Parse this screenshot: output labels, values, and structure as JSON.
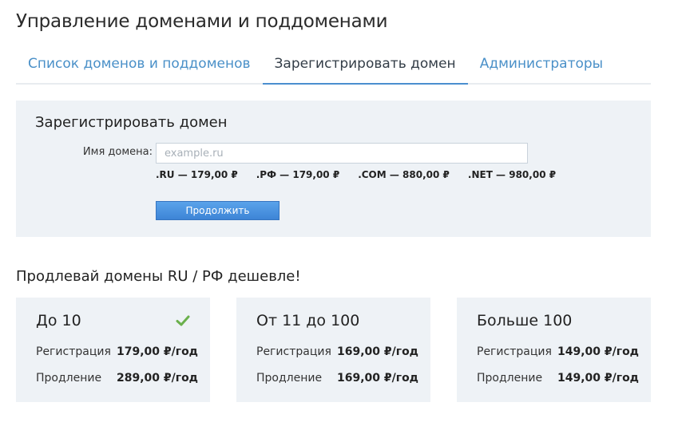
{
  "page": {
    "title": "Управление доменами и поддоменами"
  },
  "tabs": [
    {
      "label": "Список доменов и поддоменов"
    },
    {
      "label": "Зарегистрировать домен"
    },
    {
      "label": "Администраторы"
    }
  ],
  "register": {
    "title": "Зарегистрировать домен",
    "domain_label": "Имя домена:",
    "domain_value": "",
    "domain_placeholder": "example.ru",
    "prices": [
      ".RU — 179,00 ₽",
      ".РФ — 179,00 ₽",
      ".COM — 880,00 ₽",
      ".NET — 980,00 ₽"
    ],
    "continue_label": "Продолжить"
  },
  "promo": {
    "title": "Продлевай домены RU / РФ дешевле!",
    "tiers": [
      {
        "name": "До 10",
        "selected": true,
        "icon": "check-icon",
        "registration_label": "Регистрация",
        "registration_price": "179,00 ₽/год",
        "renewal_label": "Продление",
        "renewal_price": "289,00 ₽/год"
      },
      {
        "name": "От 11 до 100",
        "selected": false,
        "registration_label": "Регистрация",
        "registration_price": "169,00 ₽/год",
        "renewal_label": "Продление",
        "renewal_price": "169,00 ₽/год"
      },
      {
        "name": "Больше 100",
        "selected": false,
        "registration_label": "Регистрация",
        "registration_price": "149,00 ₽/год",
        "renewal_label": "Продление",
        "renewal_price": "149,00 ₽/год"
      }
    ]
  },
  "colors": {
    "accent": "#4a8fcf",
    "panel_bg": "#eef2f6",
    "check": "#6ab04c",
    "button": "#4a90dc"
  }
}
